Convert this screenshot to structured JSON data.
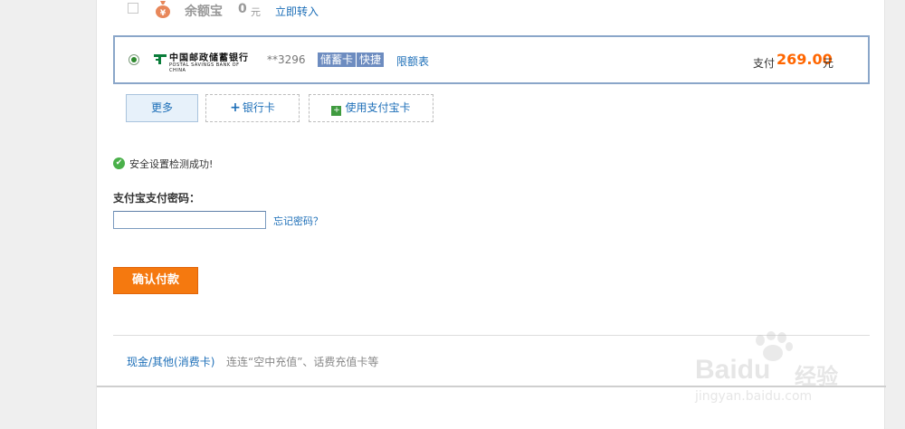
{
  "yuebao": {
    "name": "余额宝",
    "amount": "0",
    "unit": "元",
    "transfer_link": "立即转入"
  },
  "bank_card": {
    "bank_name_cn": "中国邮政储蓄银行",
    "bank_name_en": "POSTAL SAVINGS BANK OF CHINA",
    "card_number": "**3296",
    "card_type": "储蓄卡",
    "quick_tag": "快捷",
    "limit_link": "限额表",
    "pay_label": "支付",
    "pay_amount": "269.00",
    "pay_unit": "元",
    "selected": true
  },
  "options": {
    "more": "更多",
    "add_bank_card": "银行卡",
    "use_alipay_card": "使用支付宝卡"
  },
  "security": {
    "check_text": "安全设置检测成功!"
  },
  "password": {
    "label": "支付宝支付密码：",
    "value": "",
    "forgot_link": "忘记密码？"
  },
  "confirm_button": "确认付款",
  "footer": {
    "cash_title": "现金/其他(消费卡)",
    "cash_desc": "连连“空中充值”、话费充值卡等"
  },
  "watermark": {
    "brand": "Baidu",
    "brand_cn": "经验",
    "url": "jingyan.baidu.com"
  },
  "colors": {
    "accent_orange": "#ff6600",
    "link_blue": "#1d6fb8",
    "confirm_button": "#f5790f"
  }
}
